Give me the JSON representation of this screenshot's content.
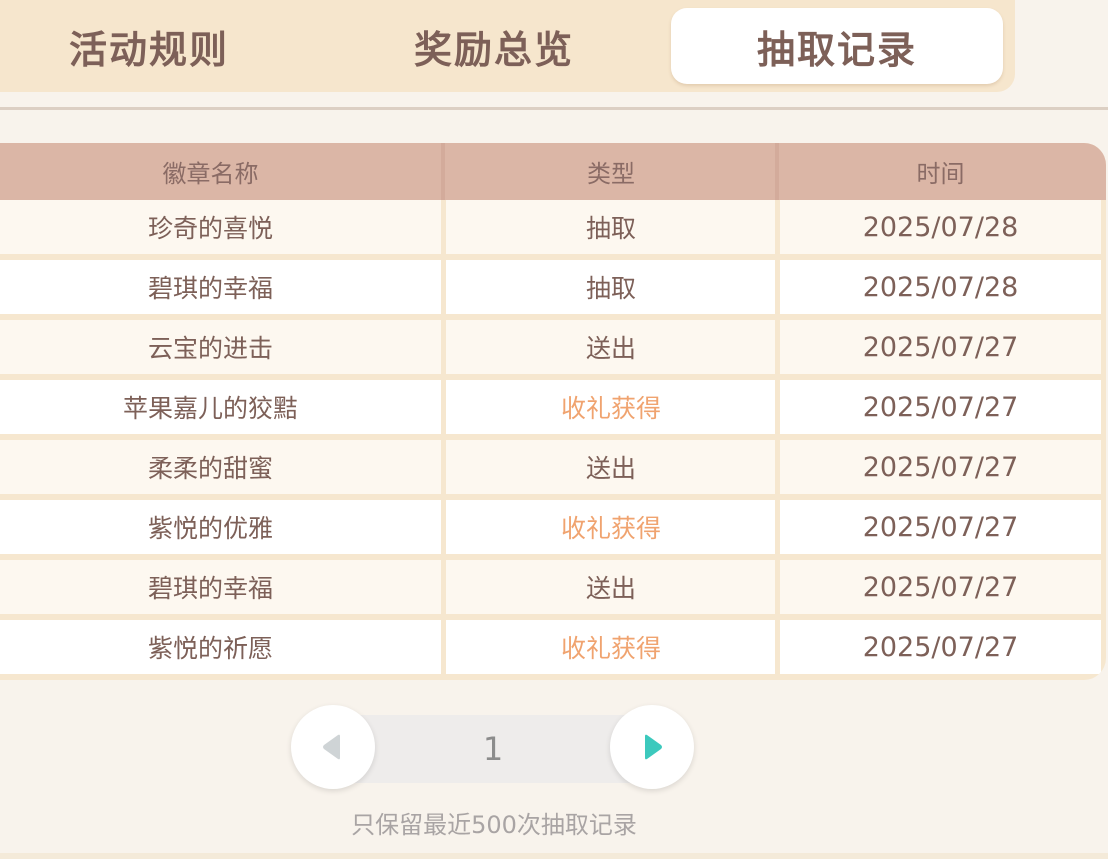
{
  "tabs": [
    {
      "label": "活动规则",
      "active": false
    },
    {
      "label": "奖励总览",
      "active": false
    },
    {
      "label": "抽取记录",
      "active": true
    }
  ],
  "table": {
    "headers": [
      "徽章名称",
      "类型",
      "时间"
    ],
    "rows": [
      {
        "name": "珍奇的喜悦",
        "type": "抽取",
        "date": "2025/07/28"
      },
      {
        "name": "碧琪的幸福",
        "type": "抽取",
        "date": "2025/07/28"
      },
      {
        "name": "云宝的进击",
        "type": "送出",
        "date": "2025/07/27"
      },
      {
        "name": "苹果嘉儿的狡黠",
        "type": "收礼获得",
        "date": "2025/07/27"
      },
      {
        "name": "柔柔的甜蜜",
        "type": "送出",
        "date": "2025/07/27"
      },
      {
        "name": "紫悦的优雅",
        "type": "收礼获得",
        "date": "2025/07/27"
      },
      {
        "name": "碧琪的幸福",
        "type": "送出",
        "date": "2025/07/27"
      },
      {
        "name": "紫悦的祈愿",
        "type": "收礼获得",
        "date": "2025/07/27"
      }
    ]
  },
  "pagination": {
    "current_page": "1",
    "prev_icon": "triangle-left-icon",
    "next_icon": "triangle-right-icon",
    "prev_enabled": false,
    "next_enabled": true
  },
  "note": "只保留最近500次抽取记录",
  "colors": {
    "tab_bar": "#f6e6cd",
    "header": "#dbb6a6",
    "text": "#7d6058",
    "gift_type": "#f0a36f",
    "next_arrow": "#3cc9bd",
    "prev_arrow": "#cfd4d6"
  }
}
